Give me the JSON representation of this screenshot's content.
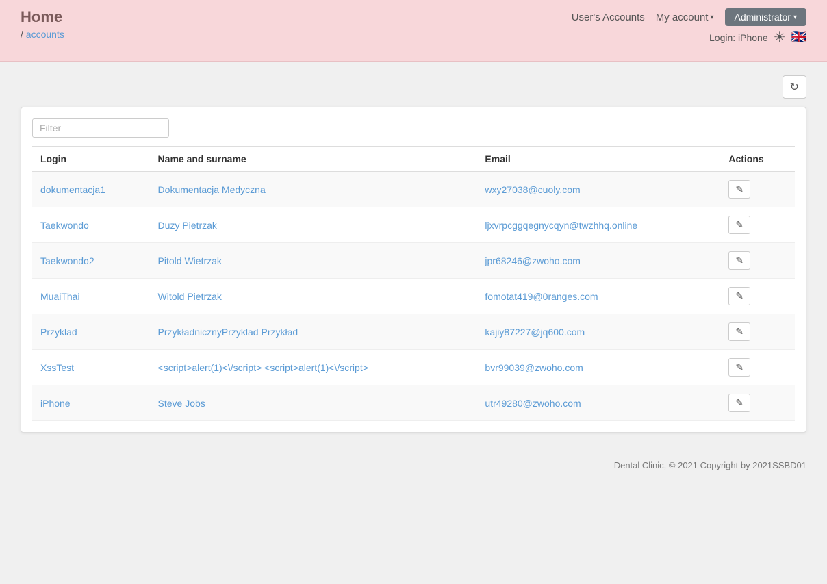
{
  "header": {
    "title": "Home",
    "breadcrumb_separator": "/",
    "breadcrumb_link_text": "accounts",
    "breadcrumb_link_href": "#",
    "users_accounts_label": "User's Accounts",
    "my_account_label": "My account",
    "administrator_label": "Administrator",
    "login_label": "Login: iPhone",
    "sun_icon": "☀",
    "flag_icon": "🇬🇧"
  },
  "toolbar": {
    "refresh_icon": "↻"
  },
  "filter": {
    "placeholder": "Filter"
  },
  "table": {
    "columns": [
      {
        "id": "login",
        "label": "Login"
      },
      {
        "id": "name",
        "label": "Name and surname"
      },
      {
        "id": "email",
        "label": "Email"
      },
      {
        "id": "actions",
        "label": "Actions"
      }
    ],
    "rows": [
      {
        "login": "dokumentacja1",
        "name": "Dokumentacja Medyczna",
        "email": "wxy27038@cuoly.com"
      },
      {
        "login": "Taekwondo",
        "name": "Duzy Pietrzak",
        "email": "ljxvrpcggqegnycqyn@twzhhq.online"
      },
      {
        "login": "Taekwondo2",
        "name": "Pitold Wietrzak",
        "email": "jpr68246@zwoho.com"
      },
      {
        "login": "MuaiThai",
        "name": "Witold Pietrzak",
        "email": "fomotat419@0ranges.com"
      },
      {
        "login": "Przyklad",
        "name": "PrzykładnicznyPrzyklad Przykład",
        "email": "kajiy87227@jq600.com"
      },
      {
        "login": "XssTest",
        "name": "<script>alert(1)<\\/script> <script>alert(1)<\\/script>",
        "email": "bvr99039@zwoho.com"
      },
      {
        "login": "iPhone",
        "name": "Steve Jobs",
        "email": "utr49280@zwoho.com"
      }
    ],
    "action_icon": "✎"
  },
  "footer": {
    "text": "Dental Clinic, © 2021 Copyright by 2021SSBD01"
  }
}
